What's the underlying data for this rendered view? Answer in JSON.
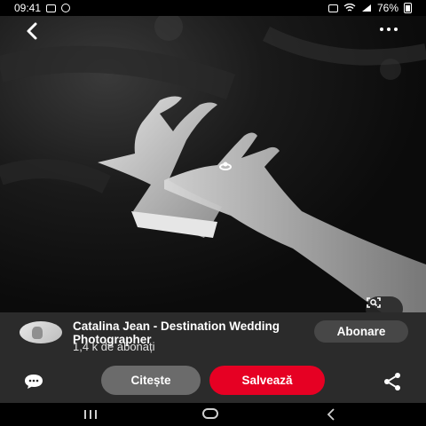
{
  "status_bar": {
    "time": "09:41",
    "battery": "76%"
  },
  "pin": {
    "author_name": "Catalina Jean - Destination Wedding Photographer",
    "followers": "1,4 k de abonați",
    "follow_label": "Abonare",
    "read_label": "Citește",
    "save_label": "Salvează"
  },
  "colors": {
    "save_accent": "#e60023",
    "panel_bg": "#2b2b2b",
    "read_button_bg": "#6b6b6b",
    "follow_button_bg": "#474747"
  },
  "icons": {
    "back": "back-arrow-icon",
    "more": "more-options-icon",
    "visual_search": "visual-search-icon",
    "comment": "comment-icon",
    "share": "share-icon"
  }
}
